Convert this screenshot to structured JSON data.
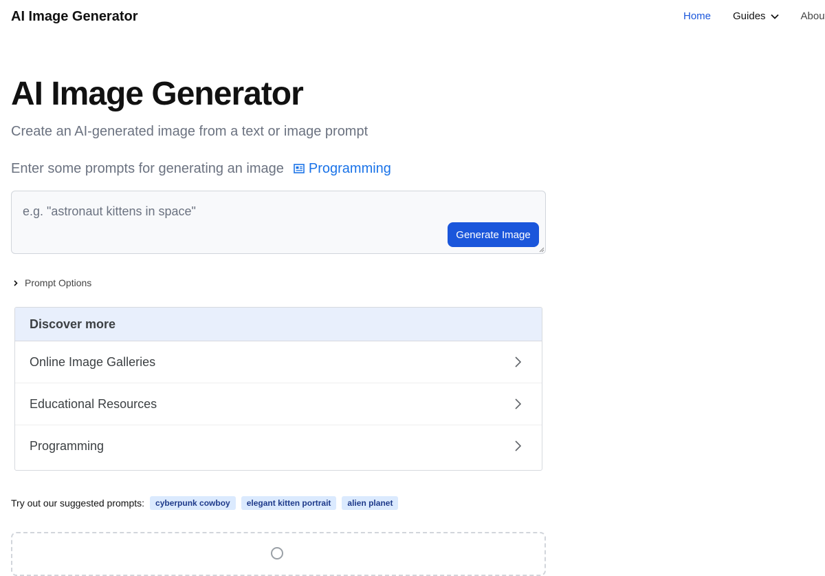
{
  "header": {
    "brand": "AI Image Generator",
    "nav": {
      "home": "Home",
      "guides": "Guides",
      "about": "About"
    }
  },
  "hero": {
    "title": "AI Image Generator",
    "subtitle": "Create an AI-generated image from a text or image prompt",
    "prompt_intro": "Enter some prompts for generating an image",
    "prompt_link": "Programming"
  },
  "prompt": {
    "placeholder": "e.g. \"astronaut kittens in space\"",
    "value": "",
    "button": "Generate Image"
  },
  "options": {
    "label": "Prompt Options"
  },
  "discover": {
    "title": "Discover more",
    "items": [
      {
        "label": "Online Image Galleries"
      },
      {
        "label": "Educational Resources"
      },
      {
        "label": "Programming"
      }
    ]
  },
  "suggestions": {
    "label": "Try out our suggested prompts:",
    "chips": [
      "cyberpunk cowboy",
      "elegant kitten portrait",
      "alien planet"
    ]
  },
  "colors": {
    "accent": "#1a56db",
    "link": "#1a73e8",
    "discover_header_bg": "#e8effc",
    "chip_bg": "#dbeafe"
  },
  "icons": {
    "guides_dropdown": "chevron-down-icon",
    "prompt_link": "document-icon",
    "options_toggle": "chevron-right-icon",
    "discover_row": "chevron-right-icon",
    "upload": "upload-icon"
  }
}
